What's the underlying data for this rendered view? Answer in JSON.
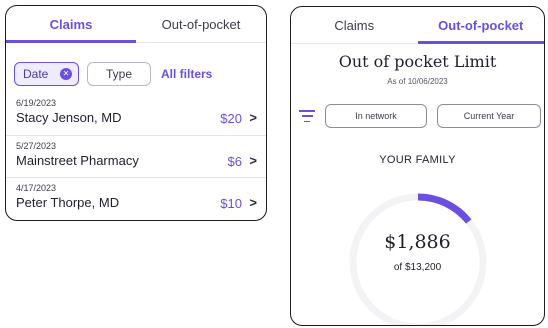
{
  "claims_panel": {
    "tabs": [
      {
        "label": "Claims"
      },
      {
        "label": "Out-of-pocket"
      }
    ],
    "filters": {
      "date_label": "Date",
      "type_label": "Type",
      "all_filters_label": "All filters"
    },
    "claims": [
      {
        "date": "6/19/2023",
        "name": "Stacy Jenson, MD",
        "amount": "$20"
      },
      {
        "date": "5/27/2023",
        "name": "Mainstreet Pharmacy",
        "amount": "$6"
      },
      {
        "date": "4/17/2023",
        "name": "Peter Thorpe, MD",
        "amount": "$10"
      }
    ]
  },
  "oop_panel": {
    "tabs": [
      {
        "label": "Claims"
      },
      {
        "label": "Out-of-pocket"
      }
    ],
    "title": "Out of pocket Limit",
    "as_of": "As of 10/06/2023",
    "buttons": {
      "network": "In network",
      "year": "Current Year"
    },
    "section_label": "YOUR FAMILY",
    "spent": "$1,886",
    "limit": "of $13,200",
    "progress_fraction": 0.1425
  },
  "colors": {
    "accent": "#6b4fe0",
    "track": "#f3f3f6"
  }
}
